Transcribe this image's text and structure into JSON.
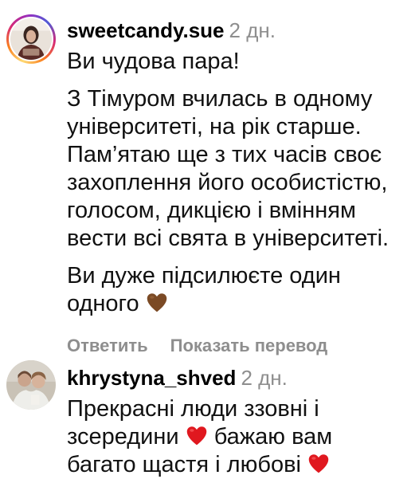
{
  "comments": [
    {
      "username": "sweetcandy.sue",
      "time": "2 дн.",
      "paragraphs": [
        "Ви чудова пара!",
        "З Тімуром вчилась в одному університеті, на рік старше. Пам’ятаю ще з тих часів своє захоплення його особистістю, голосом, дикцією і вмінням вести всі свята в університеті.",
        "Ви дуже підсилюєте один одного"
      ],
      "emoji": "brown-heart-icon",
      "actions": {
        "reply": "Ответить",
        "translate": "Показать перевод"
      }
    },
    {
      "username": "khrystyna_shved",
      "time": "2 дн.",
      "segments": {
        "s1": "Прекрасні люди ззовні і зсередини",
        "s2": "бажаю вам багато щастя і любові"
      },
      "emoji": "red-heart-icon"
    }
  ],
  "colors": {
    "muted_text": "#8e8e8e",
    "story_ring": "#d62976",
    "brown_heart": "#7b4a25",
    "red_heart": "#e0181f"
  }
}
